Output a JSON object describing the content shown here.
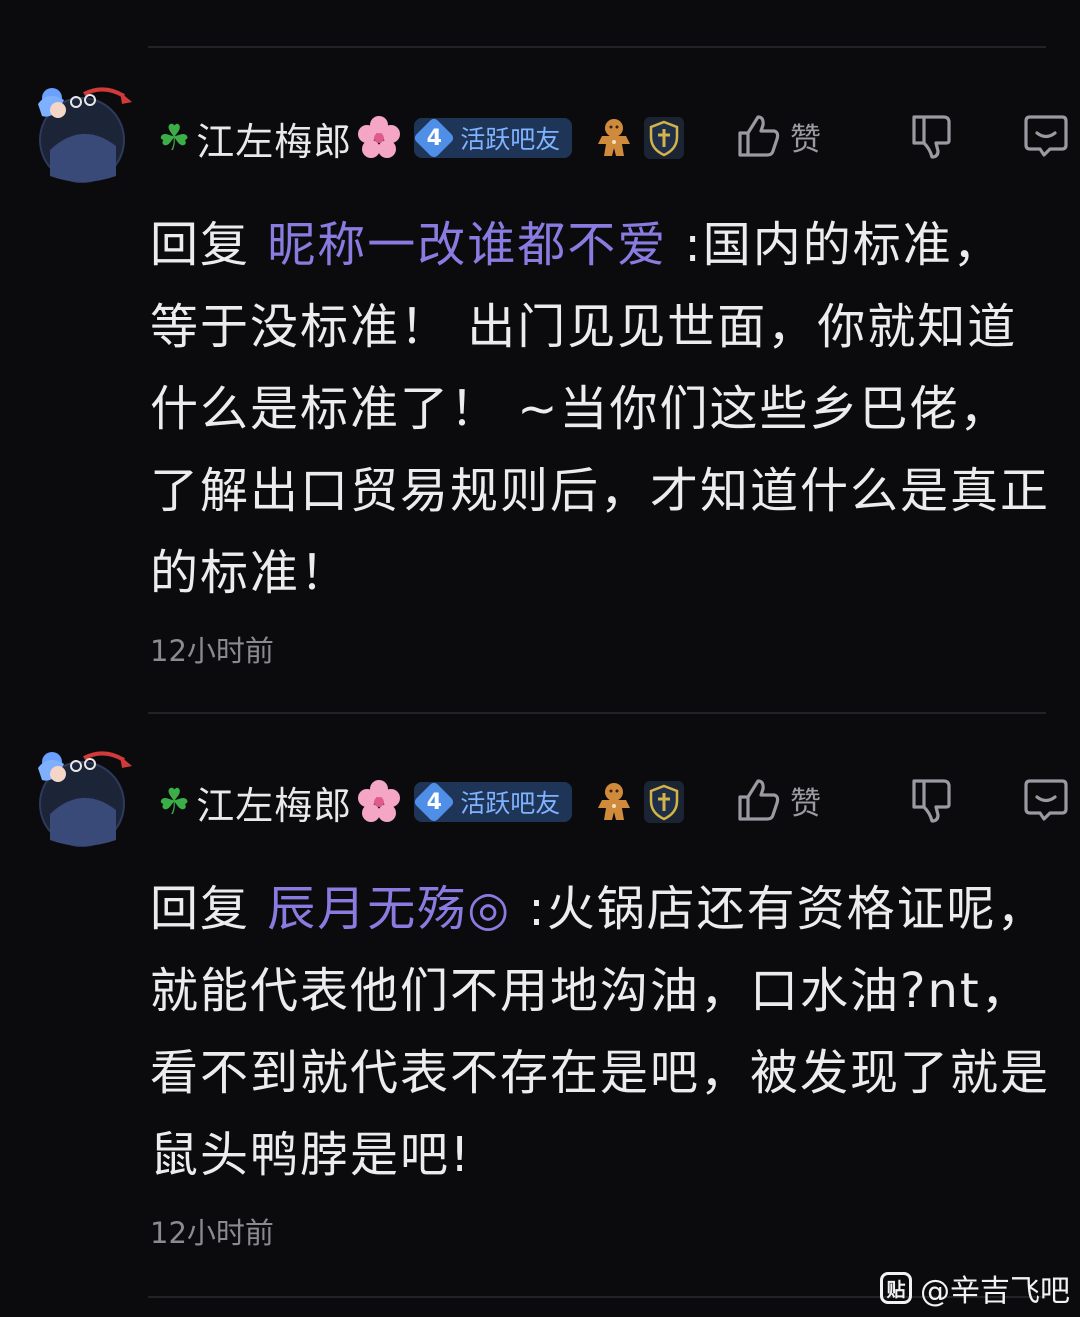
{
  "posts": [
    {
      "username": "江左梅郎",
      "level": "4",
      "level_label": "活跃吧友",
      "like_label": "赞",
      "reply_word": "回复",
      "mention": "昵称一改谁都不爱",
      "content": " :国内的标准，等于没标准！ 出门见见世面，你就知道什么是标准了！ ~当你们这些乡巴佬，了解出口贸易规则后，才知道什么是真正的标准！",
      "time": "12小时前"
    },
    {
      "username": "江左梅郎",
      "level": "4",
      "level_label": "活跃吧友",
      "like_label": "赞",
      "reply_word": "回复",
      "mention": "辰月无殇◎",
      "content": " :火锅店还有资格证呢，就能代表他们不用地沟油，口水油?nt，看不到就代表不存在是吧，被发现了就是鼠头鸭脖是吧!",
      "time": "12小时前"
    }
  ],
  "watermark": {
    "icon_text": "贴",
    "text": "@辛吉飞吧"
  },
  "colors": {
    "background": "#0b0b0d",
    "mention": "#8a7be0",
    "level_badge": "#1f3558",
    "level_label": "#7fb3ff"
  },
  "icons": [
    "four-leaf-clover-icon",
    "cherry-blossom-icon",
    "gingerbread-icon",
    "shield-icon",
    "thumbs-up-icon",
    "thumbs-down-icon",
    "comment-icon",
    "tieba-logo-icon"
  ]
}
